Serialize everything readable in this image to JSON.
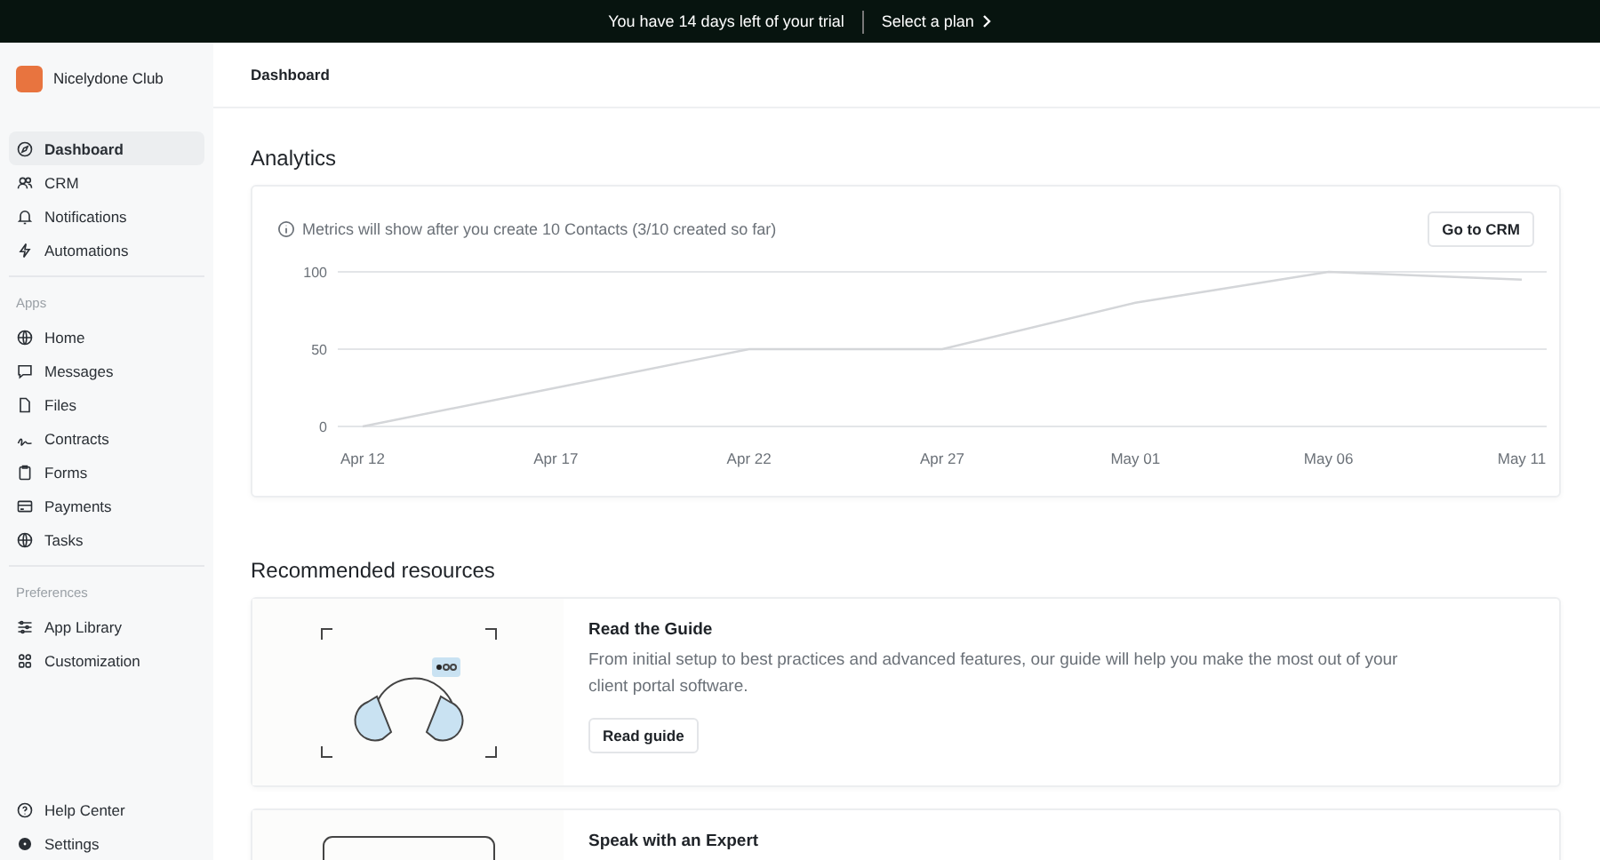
{
  "banner": {
    "message": "You have 14 days left of your trial",
    "action": "Select a plan"
  },
  "sidebar": {
    "brand": "Nicelydone Club",
    "sections": [
      {
        "items": [
          {
            "label": "Dashboard",
            "selected": true
          },
          {
            "label": "CRM",
            "selected": false
          },
          {
            "label": "Notifications",
            "selected": false
          },
          {
            "label": "Automations",
            "selected": false
          }
        ]
      },
      {
        "title": "Apps",
        "items": [
          {
            "label": "Home",
            "selected": false
          },
          {
            "label": "Messages",
            "selected": false
          },
          {
            "label": "Files",
            "selected": false
          },
          {
            "label": "Contracts",
            "selected": false
          },
          {
            "label": "Forms",
            "selected": false
          },
          {
            "label": "Payments",
            "selected": false
          },
          {
            "label": "Tasks",
            "selected": false
          }
        ]
      },
      {
        "title": "Preferences",
        "items": [
          {
            "label": "App Library",
            "selected": false
          },
          {
            "label": "Customization",
            "selected": false
          }
        ]
      }
    ],
    "footer": [
      {
        "label": "Help Center",
        "selected": false
      },
      {
        "label": "Settings",
        "selected": false
      }
    ]
  },
  "header": {
    "title": "Dashboard"
  },
  "analytics": {
    "title": "Analytics",
    "notice": "Metrics will show after you create 10 Contacts (3/10 created so far)",
    "button": "Go to CRM",
    "chart_data": {
      "type": "line",
      "categories": [
        "Apr 12",
        "Apr 17",
        "Apr 22",
        "Apr 27",
        "May 01",
        "May 06",
        "May 11"
      ],
      "yticks": [
        0,
        50,
        100
      ],
      "ylim": [
        0,
        100
      ],
      "series": [
        {
          "color": "#d4d6d9",
          "values": [
            0,
            25,
            50,
            50,
            80,
            100,
            95
          ]
        }
      ]
    }
  },
  "resources": {
    "title": "Recommended resources",
    "items": [
      {
        "kind": "guide",
        "title": "Read the Guide",
        "description": "From initial setup to best practices and advanced features, our guide will help you make the most out of your client portal software.",
        "button": "Read guide"
      },
      {
        "kind": "expert",
        "title": "Speak with an Expert"
      }
    ]
  }
}
